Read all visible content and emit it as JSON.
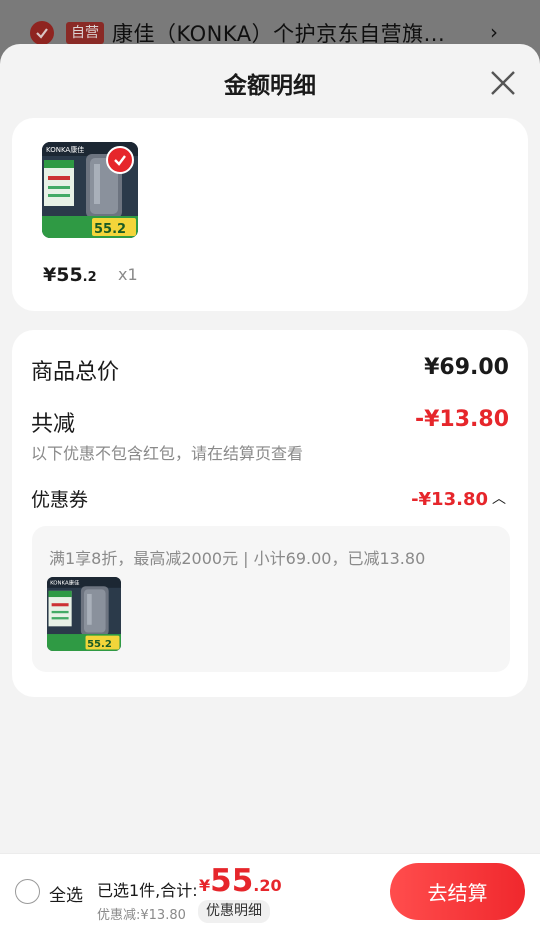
{
  "store": {
    "self_tag": "自营",
    "name": "康佳（KONKA）个护京东自营旗...",
    "arrow": "›"
  },
  "sheet": {
    "title": "金额明细"
  },
  "product": {
    "price_int": "¥55",
    "price_dec": ".2",
    "quantity": "x1",
    "thumb_brand": "KONKA康佳",
    "thumb_price": "55.2"
  },
  "detail": {
    "total_label": "商品总价",
    "total_value": "¥69.00",
    "reduce_label": "共减",
    "reduce_value": "-¥13.80",
    "reduce_note": "以下优惠不包含红包，请在结算页查看",
    "coupon_label": "优惠券",
    "coupon_value": "-¥13.80",
    "coupon_desc": "满1享8折，最高减2000元 | 小计69.00，已减13.80"
  },
  "footer": {
    "select_all": "全选",
    "summary": "已选1件,合计:",
    "currency": "¥",
    "total_int": "55",
    "total_dec": ".20",
    "discount": "优惠减:¥13.80",
    "detail_link": "优惠明细",
    "checkout": "去结算"
  },
  "colors": {
    "accent": "#e6262b",
    "checkout_start": "#ff4d4d",
    "checkout_end": "#f0282d",
    "sheet_bg": "#f3f3f3"
  }
}
